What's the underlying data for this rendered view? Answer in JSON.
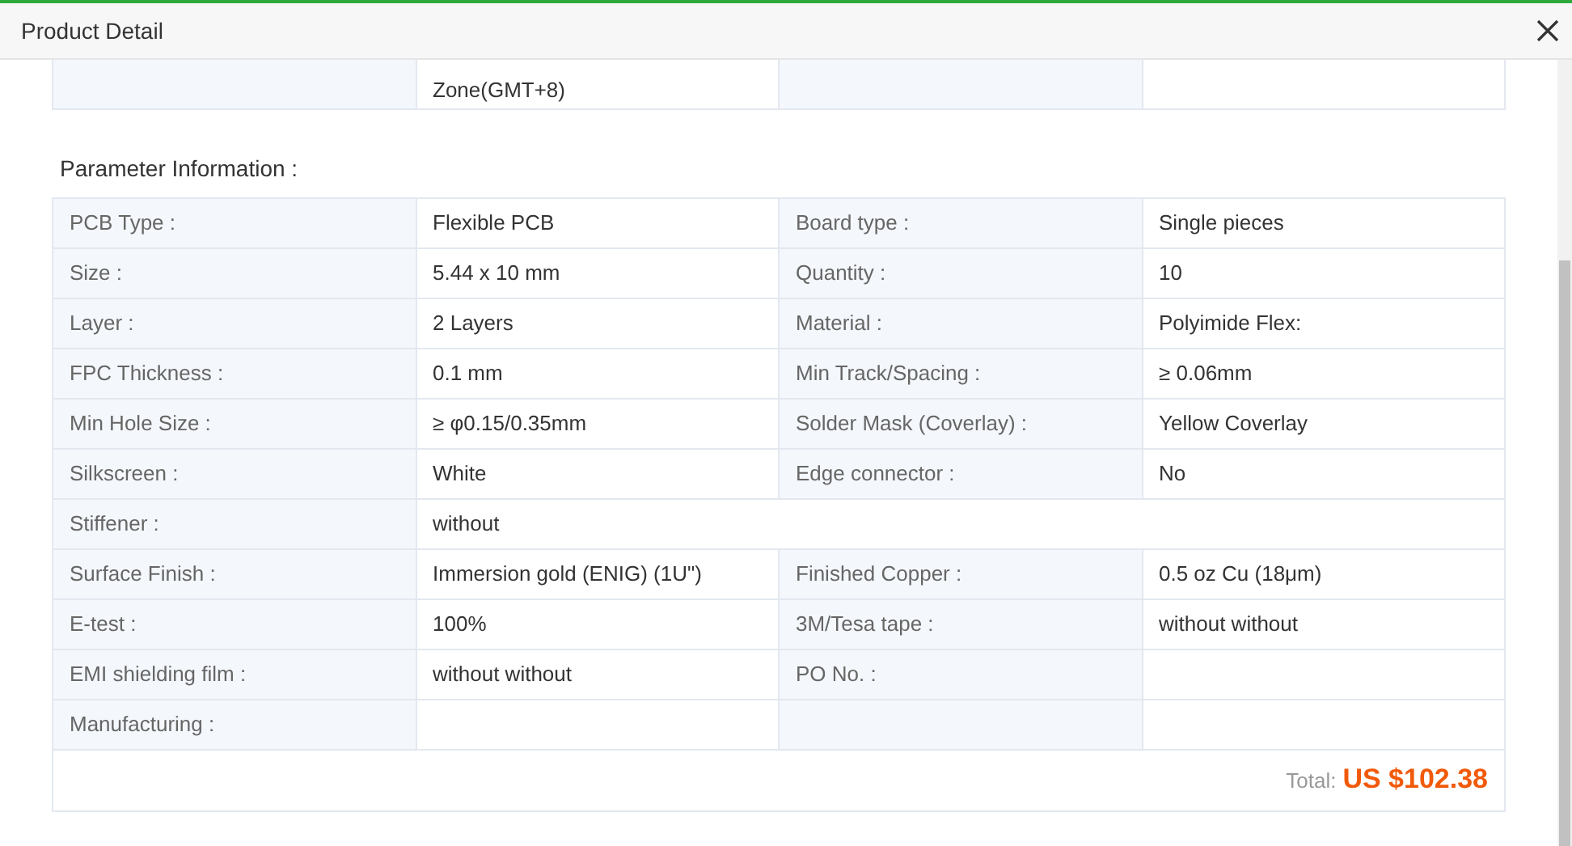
{
  "dialog": {
    "title": "Product Detail"
  },
  "order_rows": [
    {
      "cells": [
        {
          "value": "Zone(GMT+8)"
        },
        {}
      ]
    }
  ],
  "section_title": "Parameter Information :",
  "parameter_rows": [
    {
      "kind": "pair",
      "cells": [
        {
          "label": "PCB Type :",
          "value": "Flexible PCB"
        },
        {
          "label": "Board type :",
          "value": "Single pieces"
        }
      ]
    },
    {
      "kind": "pair",
      "cells": [
        {
          "label": "Size :",
          "value": "5.44 x 10 mm"
        },
        {
          "label": "Quantity :",
          "value": "10"
        }
      ]
    },
    {
      "kind": "pair",
      "cells": [
        {
          "label": "Layer :",
          "value": "2 Layers"
        },
        {
          "label": "Material :",
          "value": "Polyimide Flex:"
        }
      ]
    },
    {
      "kind": "pair",
      "cells": [
        {
          "label": "FPC Thickness :",
          "value": "0.1 mm"
        },
        {
          "label": "Min Track/Spacing :",
          "value": "≥ 0.06mm"
        }
      ]
    },
    {
      "kind": "pair",
      "cells": [
        {
          "label": "Min Hole Size :",
          "value": "≥ φ0.15/0.35mm"
        },
        {
          "label": "Solder Mask (Coverlay) :",
          "value": "Yellow Coverlay"
        }
      ]
    },
    {
      "kind": "pair",
      "cells": [
        {
          "label": "Silkscreen :",
          "value": "White"
        },
        {
          "label": "Edge connector :",
          "value": "No"
        }
      ]
    },
    {
      "kind": "full",
      "cells": [
        {
          "label": "Stiffener :",
          "value": "without"
        }
      ]
    },
    {
      "kind": "pair",
      "cells": [
        {
          "label": "Surface Finish :",
          "value": "Immersion gold (ENIG) (1U\")"
        },
        {
          "label": "Finished Copper :",
          "value": "0.5 oz Cu (18μm)"
        }
      ]
    },
    {
      "kind": "pair",
      "cells": [
        {
          "label": "E-test :",
          "value": "100%"
        },
        {
          "label": "3M/Tesa tape :",
          "value": "without without"
        }
      ]
    },
    {
      "kind": "pair",
      "cells": [
        {
          "label": "EMI shielding film :",
          "value": "without without"
        },
        {
          "label": "PO No. :"
        }
      ]
    },
    {
      "kind": "pair",
      "cells": [
        {
          "label": "Manufacturing :"
        },
        {}
      ]
    }
  ],
  "total": {
    "label": "Total:",
    "amount": "US $102.38"
  }
}
